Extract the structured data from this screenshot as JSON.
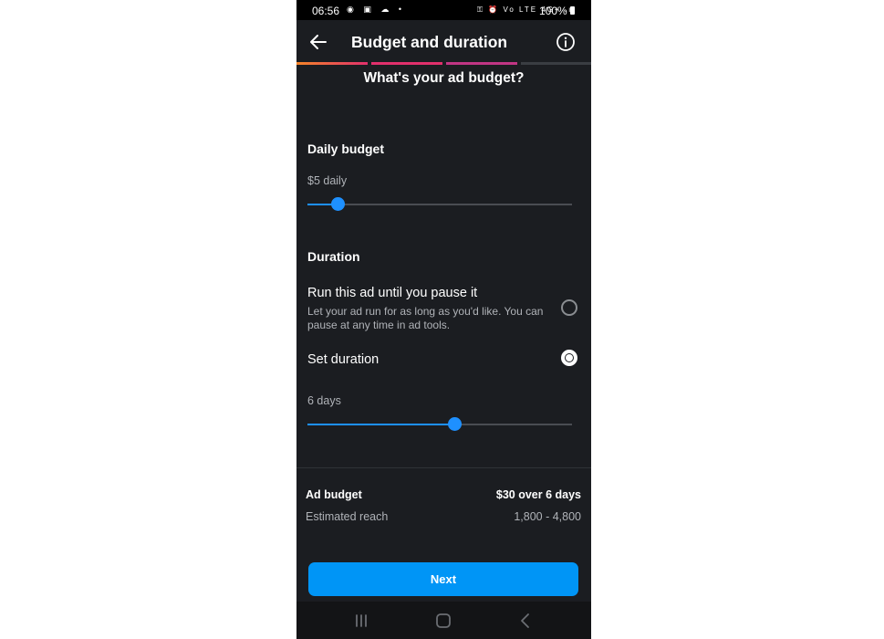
{
  "status_bar": {
    "time": "06:56",
    "left_icons": "◉ ▣ ☁ •",
    "right_icons": "⚿ ⏰ Vo LTE 4G+ .ıl",
    "battery": "100%"
  },
  "header": {
    "title": "Budget and duration",
    "back_icon": "arrow-left-icon",
    "info_icon": "info-circle-icon"
  },
  "progress": {
    "colors": [
      "#f58529",
      "#e1306c",
      "#c13584",
      "#3a3d42"
    ],
    "completed_steps": 3,
    "total_steps": 4
  },
  "question": "What's your ad budget?",
  "daily_budget": {
    "label": "Daily budget",
    "value_text": "$5 daily",
    "slider_fraction": 0.115
  },
  "duration": {
    "label": "Duration",
    "options": [
      {
        "title": "Run this ad until you pause it",
        "description": "Let your ad run for as long as you'd like. You can pause at any time in ad tools.",
        "selected": false
      },
      {
        "title": "Set duration",
        "selected": true
      }
    ],
    "value_text": "6 days",
    "slider_fraction": 0.555
  },
  "summary": {
    "budget_label": "Ad budget",
    "budget_value": "$30 over 6 days",
    "reach_label": "Estimated reach",
    "reach_value": "1,800 - 4,800"
  },
  "next_button": "Next",
  "accent_color": "#0095f6"
}
